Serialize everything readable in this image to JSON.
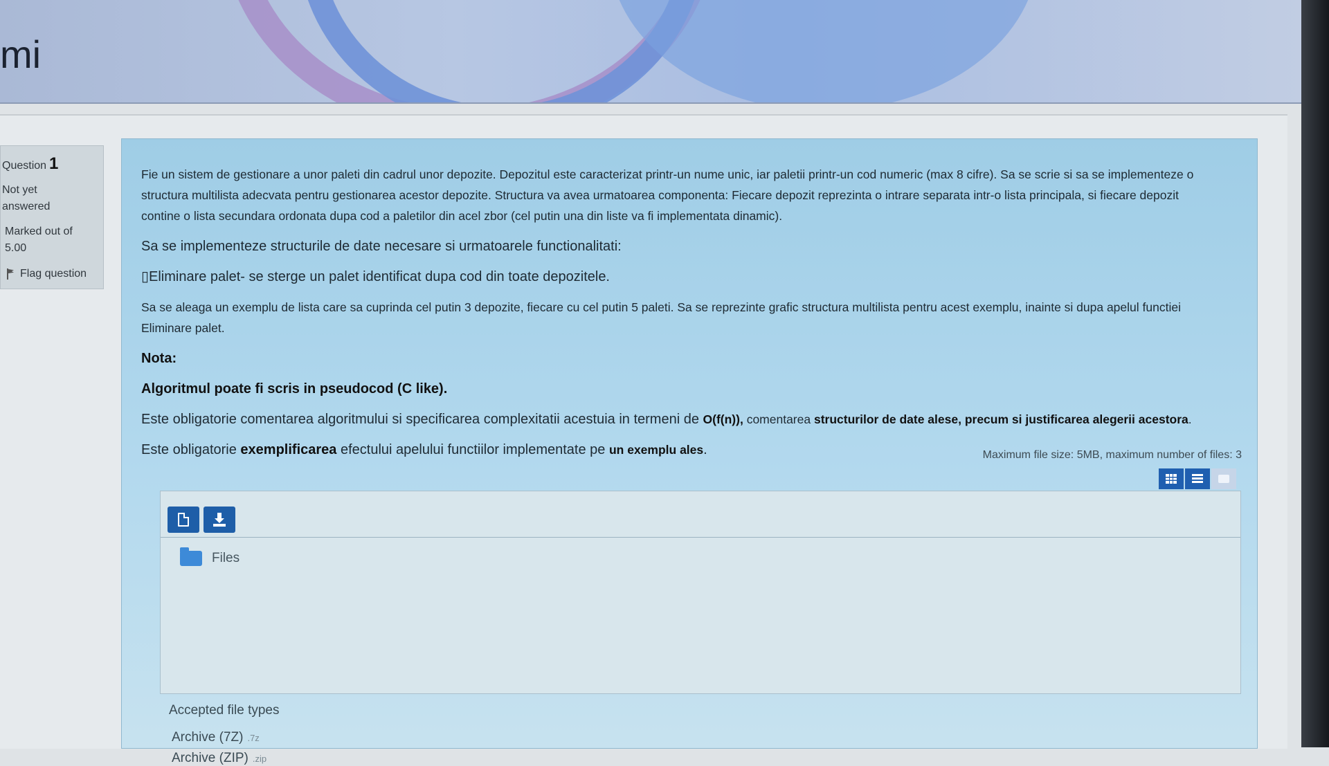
{
  "banner": {
    "title_fragment": "mi"
  },
  "question_info": {
    "label": "Question",
    "number": "1",
    "state": "Not yet answered",
    "mark": "Marked out of 5.00",
    "flag_label": "Flag question"
  },
  "question": {
    "p1": "Fie un sistem de gestionare a unor paleti din cadrul unor depozite. Depozitul este caracterizat printr-un nume unic, iar paletii printr-un cod numeric (max 8 cifre). Sa se scrie si sa se implementeze o structura multilista adecvata pentru gestionarea acestor depozite. Structura va avea urmatoarea componenta: Fiecare depozit reprezinta o intrare separata intr-o lista principala, si fiecare depozit contine o lista secundara ordonata dupa cod a paletilor din acel zbor (cel putin una din liste va fi implementata dinamic).",
    "p2": "Sa se implementeze structurile de date necesare si urmatoarele functionalitati:",
    "p3": "Eliminare palet- se sterge un palet identificat dupa cod din toate depozitele.",
    "p4": "Sa se aleaga un exemplu de lista care sa cuprinda cel putin 3 depozite, fiecare cu cel putin 5 paleti. Sa se reprezinte grafic structura multilista pentru acest exemplu, inainte si dupa apelul functiei Eliminare palet.",
    "nota_label": "Nota:",
    "algo_note": "Algoritmul poate fi scris in pseudocod (C like).",
    "p5_a": "Este obligatorie comentarea algoritmului si specificarea complexitatii acestuia in termeni de ",
    "p5_b": "O(f(n)),",
    "p5_c": " comentarea ",
    "p5_d": "structurilor de date alese, precum si justificarea alegerii acestora",
    "p5_e": ".",
    "p6_a": "Este obligatorie ",
    "p6_b": "exemplificarea",
    "p6_c": " efectului apelului functiilor implementate pe ",
    "p6_d": "un exemplu ales",
    "p6_e": "."
  },
  "file_manager": {
    "limits": "Maximum file size: 5MB, maximum number of files: 3",
    "root_folder": "Files",
    "accepted_label": "Accepted file types",
    "types": [
      {
        "name": "Archive (7Z)",
        "ext": ".7z"
      },
      {
        "name": "Archive (ZIP)",
        "ext": ".zip"
      }
    ]
  },
  "colors": {
    "question_bg": "#b3d9ee",
    "primary_button": "#1e5ea8",
    "folder": "#3d8ad8"
  }
}
